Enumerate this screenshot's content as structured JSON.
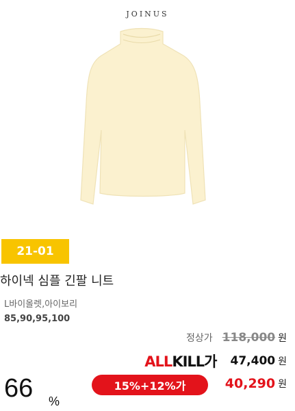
{
  "brand": "JOINUS",
  "code_badge": "21-01",
  "product": {
    "title": "하이넥 심플 긴팔 니트",
    "color": "L바이올렛,아이보리",
    "sizes": "85,90,95,100"
  },
  "pricing": {
    "regular_label": "정상가",
    "regular_price": "118,000",
    "won": "원",
    "allkill_logo_a": "ALL",
    "allkill_logo_b": "KILL",
    "allkill_logo_c": "가",
    "allkill_price": "47,400",
    "discount_badge": "15%+12%가",
    "final_price": "40,290",
    "discount_percent": "66",
    "percent_sign": "%"
  },
  "colors": {
    "badge_yellow": "#f8c400",
    "accent_red": "#e3131b",
    "sweater": "#fbf1cf"
  }
}
